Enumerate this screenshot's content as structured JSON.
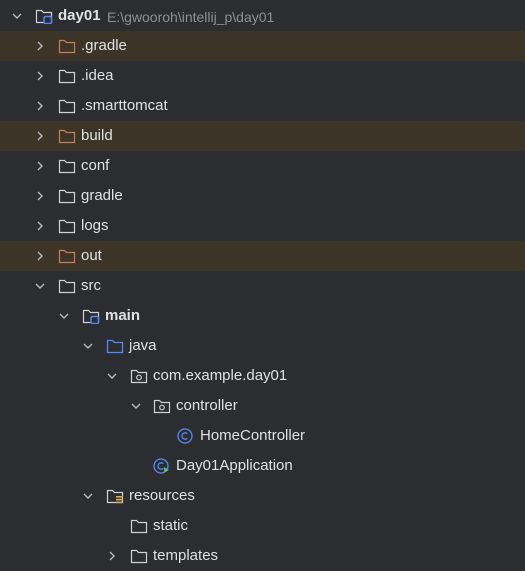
{
  "project": {
    "name": "day01",
    "path": "E:\\gwooroh\\intellij_p\\day01"
  },
  "colors": {
    "background": "#2b2d30",
    "excluded_row": "#3d3428",
    "folder_default": "#ced0d6",
    "folder_excluded": "#c77d55",
    "source_blue": "#548af7",
    "resources_yellow": "#d6ae58"
  },
  "tree": [
    {
      "label": "day01",
      "icon": "module-folder-icon"
    },
    {
      "label": ".gradle",
      "icon": "folder-excluded-icon",
      "excluded": true
    },
    {
      "label": ".idea",
      "icon": "folder-icon"
    },
    {
      "label": ".smarttomcat",
      "icon": "folder-icon"
    },
    {
      "label": "build",
      "icon": "folder-excluded-icon",
      "excluded": true
    },
    {
      "label": "conf",
      "icon": "folder-icon"
    },
    {
      "label": "gradle",
      "icon": "folder-icon"
    },
    {
      "label": "logs",
      "icon": "folder-icon"
    },
    {
      "label": "out",
      "icon": "folder-excluded-icon",
      "excluded": true
    },
    {
      "label": "src",
      "icon": "folder-icon"
    },
    {
      "label": "main",
      "icon": "module-folder-icon"
    },
    {
      "label": "java",
      "icon": "source-folder-icon"
    },
    {
      "label": "com.example.day01",
      "icon": "package-icon"
    },
    {
      "label": "controller",
      "icon": "package-icon"
    },
    {
      "label": "HomeController",
      "icon": "class-icon"
    },
    {
      "label": "Day01Application",
      "icon": "spring-boot-class-icon"
    },
    {
      "label": "resources",
      "icon": "resources-folder-icon"
    },
    {
      "label": "static",
      "icon": "folder-icon"
    },
    {
      "label": "templates",
      "icon": "folder-icon"
    }
  ]
}
